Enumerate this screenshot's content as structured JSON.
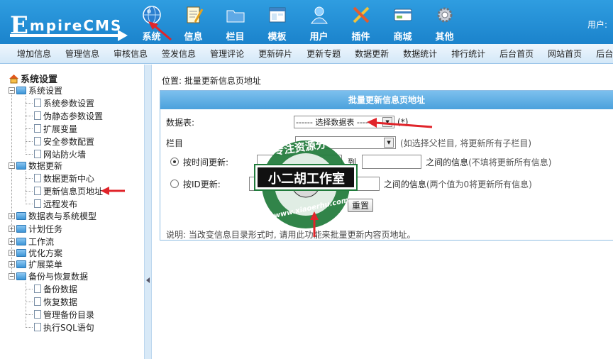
{
  "header": {
    "logo_text_cap": "E",
    "logo_text_rest": "mpireCMS",
    "user_label": "用户:",
    "nav": [
      {
        "label": "系统",
        "icon": "globe-icon",
        "active": true
      },
      {
        "label": "信息",
        "icon": "notepad-icon"
      },
      {
        "label": "栏目",
        "icon": "folder-icon"
      },
      {
        "label": "模板",
        "icon": "window-icon"
      },
      {
        "label": "用户",
        "icon": "user-icon"
      },
      {
        "label": "插件",
        "icon": "tools-icon"
      },
      {
        "label": "商城",
        "icon": "card-icon"
      },
      {
        "label": "其他",
        "icon": "gear-icon"
      }
    ]
  },
  "subnav": [
    "增加信息",
    "管理信息",
    "审核信息",
    "签发信息",
    "管理评论",
    "更新碎片",
    "更新专题",
    "数据更新",
    "数据统计",
    "排行统计",
    "后台首页",
    "网站首页",
    "后台地图"
  ],
  "sidebar": {
    "title": "系统设置",
    "groups": [
      {
        "label": "系统设置",
        "expanded": true,
        "items": [
          "系统参数设置",
          "伪静态参数设置",
          "扩展变量",
          "安全参数配置",
          "网站防火墙"
        ]
      },
      {
        "label": "数据更新",
        "expanded": true,
        "items": [
          "数据更新中心",
          "更新信息页地址",
          "远程发布"
        ]
      },
      {
        "label": "数据表与系统模型",
        "expanded": false
      },
      {
        "label": "计划任务",
        "expanded": false
      },
      {
        "label": "工作流",
        "expanded": false
      },
      {
        "label": "优化方案",
        "expanded": false
      },
      {
        "label": "扩展菜单",
        "expanded": false
      },
      {
        "label": "备份与恢复数据",
        "expanded": true,
        "items": [
          "备份数据",
          "恢复数据",
          "管理备份目录",
          "执行SQL语句"
        ]
      }
    ]
  },
  "main": {
    "breadcrumb": "位置: 批量更新信息页地址",
    "form_title": "批量更新信息页地址",
    "table_label": "数据表:",
    "table_select": "------ 选择数据表 -----",
    "table_required": "(*)",
    "column_label": "栏目",
    "column_hint": "(如选择父栏目, 将更新所有子栏目)",
    "by_time_label": "按时间更新:",
    "to_label": "到",
    "between_label_1": "之间的信息",
    "time_hint": "(不填将更新所有信息)",
    "by_id_label": "按ID更新:",
    "id_end_value": "0",
    "between_label_2": "之间的信息",
    "id_hint": "(两个值为0将更新所有信息)",
    "reset_button": "重置",
    "note": "说明: 当改变信息目录形式时, 请用此功能来批量更新内容页地址。"
  },
  "watermark": {
    "top_text": "专注资源分享",
    "banner_text": "小二胡工作室",
    "url_text": "www.xiaoerhu.com"
  },
  "colors": {
    "header_blue": "#1b83cc",
    "form_head": "#4ba1dc",
    "annotation_red": "#e0242a",
    "watermark_green": "#1f7a3a"
  }
}
